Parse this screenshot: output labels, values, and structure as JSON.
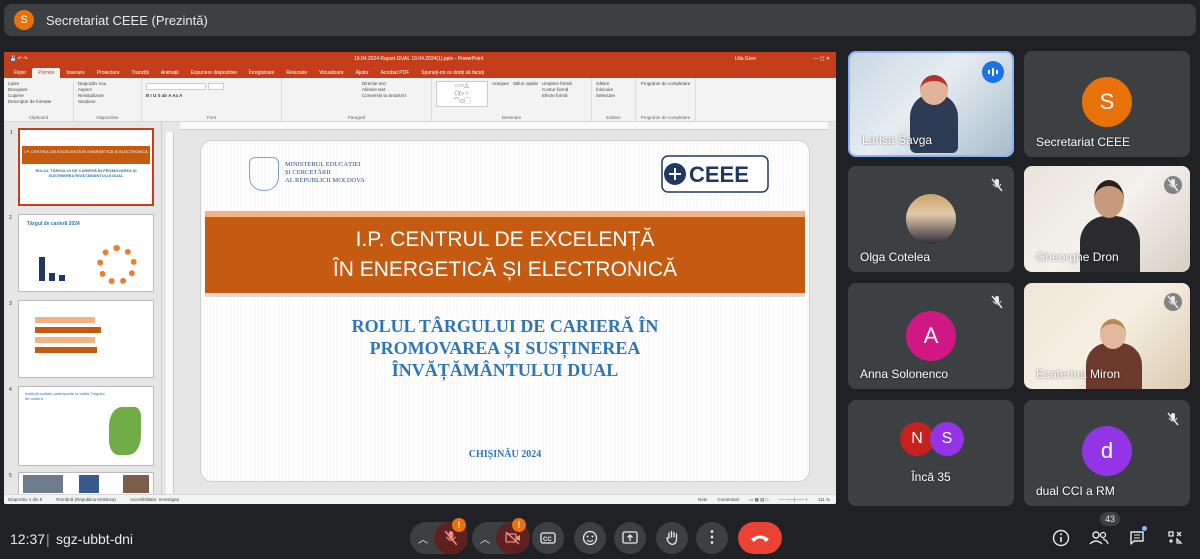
{
  "presenter_bar": {
    "avatar_letter": "S",
    "title": "Secretariat CEEE (Prezintă)"
  },
  "powerpoint": {
    "window_title": "19.04.2024 Raport DUAL 19.04.2024(1).pptx - PowerPoint",
    "user": "Lilia Gore",
    "tabs": [
      "Fișier",
      "Pornire",
      "Inserare",
      "Proiectare",
      "Tranziții",
      "Animații",
      "Expunere diapozitive",
      "Înregistrare",
      "Revizuire",
      "Vizualizare",
      "Ajutor",
      "Acrobat PDF",
      "Spuneți-mi ce doriți să faceți"
    ],
    "active_tab": "Pornire",
    "ribbon_groups": [
      {
        "label": "Clipboard",
        "items": [
          "Lipire",
          "Decupare",
          "Copiere",
          "Descriptor de formate"
        ]
      },
      {
        "label": "Diapozitive",
        "items": [
          "Diapozitiv nou",
          "Aspect",
          "Reinițializare",
          "Secțiune"
        ]
      },
      {
        "label": "Font",
        "items": []
      },
      {
        "label": "Paragraf",
        "items": [
          "Direcție text",
          "Aliniere text",
          "Conversie la SmartArt"
        ]
      },
      {
        "label": "Desenare",
        "items": [
          "Aranjare",
          "Stiluri rapide",
          "Umplere formă",
          "Contur formă",
          "Efecte formă"
        ]
      },
      {
        "label": "Editare",
        "items": [
          "Găsire",
          "Înlocuire",
          "Selectare"
        ]
      },
      {
        "label": "Programe de completare",
        "items": [
          "Programe de completare"
        ]
      }
    ],
    "slide": {
      "ministry_lines": [
        "MINISTERUL EDUCAȚIEI",
        "ȘI CERCETĂRII",
        "AL REPUBLICII MOLDOVA"
      ],
      "logo_text": "CEEE",
      "banner_line1": "I.P. CENTRUL DE EXCELENȚĂ",
      "banner_line2": "ÎN ENERGETICĂ ȘI ELECTRONICĂ",
      "subtitle_line1": "ROLUL TÂRGULUI DE CARIERĂ ÎN",
      "subtitle_line2": "PROMOVAREA ȘI SUSȚINEREA",
      "subtitle_line3": "ÎNVĂȚĂMÂNTULUI DUAL",
      "city": "CHIȘINĂU 2024"
    },
    "thumbnails": [
      "1",
      "2",
      "3",
      "4",
      "5"
    ],
    "thumb_texts": {
      "t1_head": "I.P. CENTRUL DE EXCELENȚĂ ÎN ENERGETICĂ ȘI ELECTRONICĂ",
      "t1_sub": "ROLUL TÂRGULUI DE CARIERĂ ÎN PROMOVAREA ȘI SUSȚINEREA ÎNVĂȚĂMÂNTULUI DUAL",
      "t2_title": "Târgul de carieră 2024",
      "t4_title": "Instituții invitate participante la ediția Târgului de carieră"
    },
    "status": {
      "slide_info": "Diapozitiv 1 din 9",
      "language": "Română (Republica Moldova)",
      "accessibility": "Accesibilitate: Investigați",
      "notes": "Note",
      "comments": "Comentarii",
      "zoom": "111 %"
    }
  },
  "participants": [
    {
      "name": "Larisa Savga",
      "speaking": true
    },
    {
      "name": "Secretariat CEEE",
      "avatar_letter": "S",
      "color": "#e8710a"
    },
    {
      "name": "Olga Cotelea",
      "muted": true
    },
    {
      "name": "Gheorghe Dron",
      "muted": true
    },
    {
      "name": "Anna Solonenco",
      "avatar_letter": "A",
      "color": "#d01884",
      "muted": true
    },
    {
      "name": "Ecaterina Miron",
      "muted": true
    },
    {
      "name": "Încă 35",
      "letters": [
        "N",
        "S"
      ],
      "colors": [
        "#c5221f",
        "#9334e6"
      ]
    },
    {
      "name": "dual CCI a RM",
      "avatar_letter": "d",
      "color": "#9334e6",
      "muted": true
    }
  ],
  "bottom": {
    "time": "12:37",
    "separator": "|",
    "meeting_code": "sgz-ubbt-dni",
    "mic_badge": "!",
    "cam_badge": "!",
    "people_count": "43"
  },
  "colors": {
    "accent_orange": "#c55a11",
    "ppt_red": "#c43e1c",
    "title_blue": "#2e75b6",
    "meet_red": "#ea4335"
  }
}
